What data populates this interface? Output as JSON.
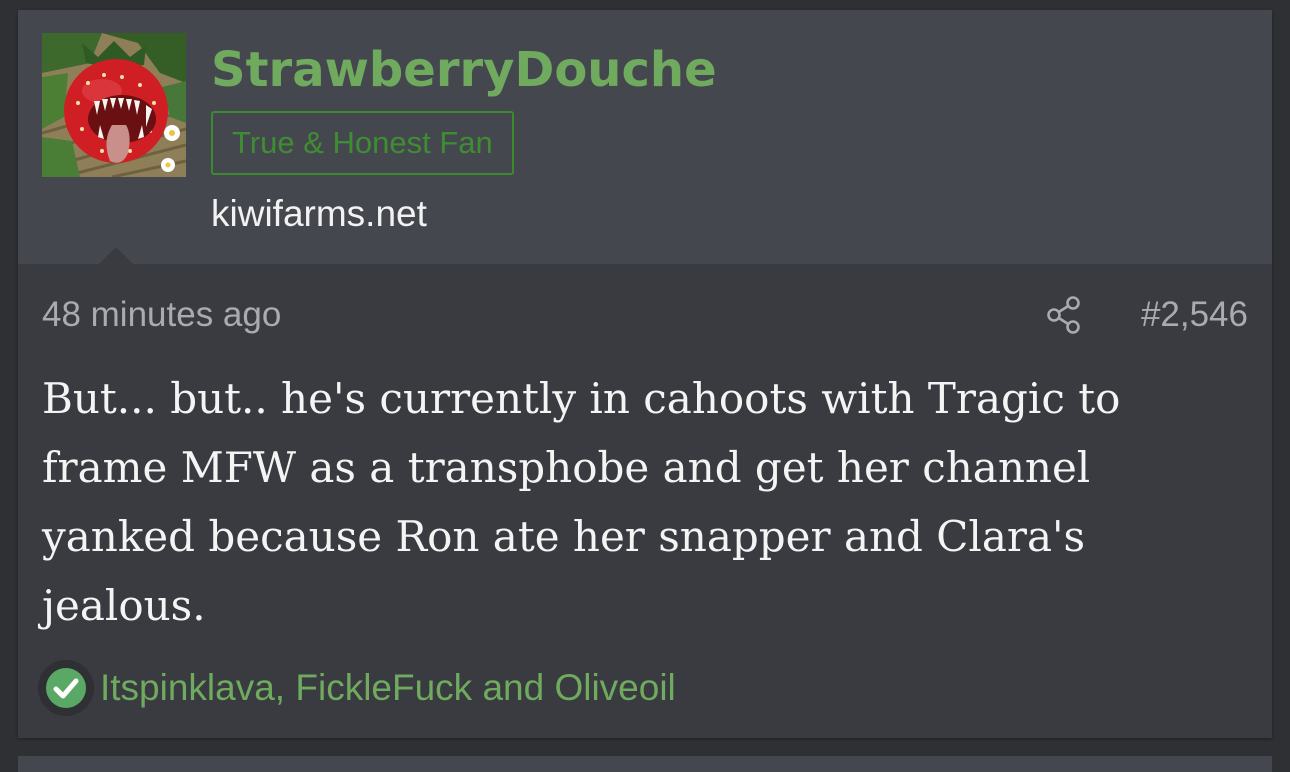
{
  "post": {
    "username": "StrawberryDouche",
    "user_title": "True & Honest Fan",
    "user_site": "kiwifarms.net",
    "time": "48 minutes ago",
    "post_number": "#2,546",
    "body": "But... but.. he's currently in cahoots with Tragic to frame MFW as a transphobe and get her channel yanked because Ron ate her snapper and Clara's jealous.",
    "reactions": {
      "icon": "check-circle-icon",
      "users": "Itspinklava, FickleFuck and Oliveoil"
    }
  },
  "icons": {
    "share": "share-icon",
    "avatar": "strawberry-fangs-avatar"
  },
  "colors": {
    "username": "#6faa5f",
    "title_border": "#3c8a2e",
    "header_bg": "#44474e",
    "post_bg": "#393b40",
    "reaction_green": "#5aa865"
  }
}
